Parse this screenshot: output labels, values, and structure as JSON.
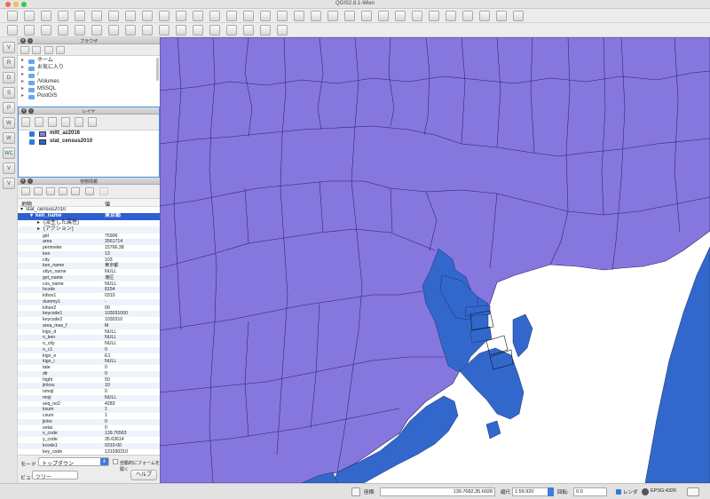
{
  "window": {
    "title": "QGIS2.8.1-Wien",
    "colors": {
      "close": "#fc605b",
      "minimize": "#fdbc40",
      "zoom": "#34c84a"
    }
  },
  "toolbar_icons": {
    "row1": [
      "new-project-icon",
      "open-project-icon",
      "save-project-icon",
      "save-as-icon",
      "print-composer-icon",
      "composer-manager-icon",
      "pan-icon",
      "pan-to-selection-icon",
      "zoom-in-icon",
      "zoom-out-icon",
      "zoom-full-icon",
      "zoom-to-selection-icon",
      "zoom-to-layer-icon",
      "zoom-actual-icon",
      "zoom-last-icon",
      "zoom-next-icon",
      "refresh-icon",
      "identify-icon",
      "help-icon",
      "select-feature-icon",
      "deselect-icon",
      "open-table-icon",
      "statistics-icon",
      "measure-icon",
      "map-tips-icon",
      "bookmark-icon",
      "show-bookmarks-icon",
      "annotation-icon",
      "text-annotation-icon",
      "python-console-icon",
      "whats-this-icon"
    ],
    "row2": [
      "edit-pencil-icon",
      "save-edits-icon",
      "add-feature-icon",
      "move-feature-icon",
      "node-tool-icon",
      "delete-selected-icon",
      "cut-icon",
      "copy-icon",
      "paste-icon",
      "label-icon",
      "label-pin-icon",
      "label-show-hide-icon",
      "label-move-icon",
      "label-rotate-icon",
      "label-change-icon",
      "label-settings-icon",
      "python-icon"
    ]
  },
  "left_toolbar": {
    "labels": [
      "V",
      "R",
      "D",
      "S",
      "P",
      "W",
      "W",
      "WC",
      "V",
      "V"
    ],
    "icons": [
      "add-vector-layer-icon",
      "add-raster-layer-icon",
      "add-postgis-layer-icon",
      "add-spatialite-layer-icon",
      "add-mssql-layer-icon",
      "add-wms-layer-icon",
      "add-wcs-layer-icon",
      "add-wfs-layer-icon",
      "add-delimited-text-icon",
      "new-vector-layer-icon"
    ]
  },
  "browser": {
    "title": "ブラウザ",
    "items": [
      {
        "label": "ホーム",
        "icon": "home-folder-icon"
      },
      {
        "label": "お気に入り",
        "icon": "favorites-star-icon"
      },
      {
        "label": "/",
        "icon": "folder-icon"
      },
      {
        "label": "/Volumes",
        "icon": "folder-icon"
      },
      {
        "label": "MSSQL",
        "icon": "mssql-icon"
      },
      {
        "label": "PostGIS",
        "icon": "postgis-icon"
      }
    ]
  },
  "layers": {
    "title": "レイヤ",
    "items": [
      {
        "name": "mltt_az2016",
        "color": "#8c7fe0",
        "checked": true
      },
      {
        "name": "stat_census2010",
        "color": "#3063c8",
        "checked": true
      }
    ]
  },
  "identify": {
    "title": "地物情報",
    "col_feature": "地物",
    "col_value": "値",
    "root": "stat_census2010",
    "selected": {
      "key": "ken_name",
      "value": "東京都"
    },
    "derived": "(派生した属性)",
    "actions": "(アクション)",
    "attrs": [
      {
        "k": "gid",
        "v": "75906"
      },
      {
        "k": "area",
        "v": "3561714"
      },
      {
        "k": "perimeter",
        "v": "15766.38"
      },
      {
        "k": "ken",
        "v": "13"
      },
      {
        "k": "city",
        "v": "103"
      },
      {
        "k": "ken_name",
        "v": "東京都"
      },
      {
        "k": "sityo_name",
        "v": "NULL"
      },
      {
        "k": "gst_name",
        "v": "港区"
      },
      {
        "k": "css_name",
        "v": "NULL"
      },
      {
        "k": "hcode",
        "v": "8154"
      },
      {
        "k": "kihon1",
        "v": "0310"
      },
      {
        "k": "dummy1",
        "v": "-"
      },
      {
        "k": "kihon2",
        "v": "00"
      },
      {
        "k": "keycode1",
        "v": "103031000"
      },
      {
        "k": "keycode2",
        "v": "1030310"
      },
      {
        "k": "area_max_f",
        "v": "M"
      },
      {
        "k": "kigo_d",
        "v": "NULL"
      },
      {
        "k": "n_ken",
        "v": "NULL"
      },
      {
        "k": "n_city",
        "v": "NULL"
      },
      {
        "k": "n_c1",
        "v": "0"
      },
      {
        "k": "kigo_e",
        "v": "E1"
      },
      {
        "k": "kigo_i",
        "v": "NULL"
      },
      {
        "k": "tate",
        "v": "0"
      },
      {
        "k": "dir",
        "v": "0"
      },
      {
        "k": "hight",
        "v": "50"
      },
      {
        "k": "jinkou",
        "v": "10"
      },
      {
        "k": "nmoji",
        "v": "0"
      },
      {
        "k": "moji",
        "v": "NULL"
      },
      {
        "k": "seq_no2",
        "v": "4283"
      },
      {
        "k": "ksum",
        "v": "1"
      },
      {
        "k": "csum",
        "v": "1"
      },
      {
        "k": "jinko",
        "v": "0"
      },
      {
        "k": "setai",
        "v": "0"
      },
      {
        "k": "x_code",
        "v": "139.76563"
      },
      {
        "k": "y_code",
        "v": "35.63614"
      },
      {
        "k": "kcode1",
        "v": "0310-00"
      },
      {
        "k": "key_code",
        "v": "131030310"
      }
    ],
    "mode_label": "モード",
    "mode_value": "トップダウン",
    "auto_open_label": "自動的にフォームを開く",
    "view_label": "ビュー",
    "view_value": "ツリー",
    "help_label": "ヘルプ"
  },
  "statusbar": {
    "coord_label": "座標:",
    "coord_value": "139.7682,35.6928",
    "scale_label": "縮尺",
    "scale_value": "1:59,920",
    "rotation_label": "回転:",
    "rotation_value": "0.0",
    "render_label": "レンダ",
    "crs_label": "EPSG:4326"
  },
  "map": {
    "background": "#ffffff",
    "land_color": "#8677de",
    "water_feature_color": "#3268cc",
    "boundary_color": "#2a1f6a"
  }
}
